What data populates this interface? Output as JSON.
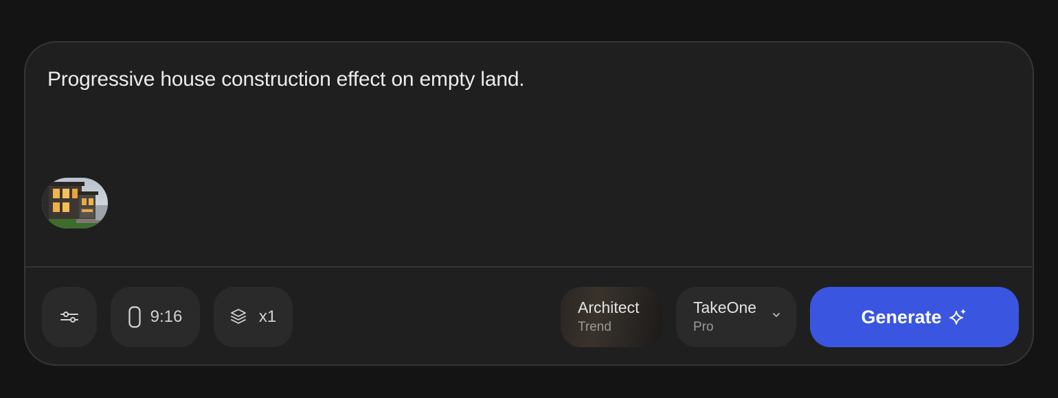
{
  "prompt": {
    "text": "Progressive house construction effect on empty land."
  },
  "attachment": {
    "icon": "house-photo-thumbnail"
  },
  "toolbar": {
    "settings_icon": "sliders-icon",
    "aspect_ratio": {
      "icon": "portrait-frame-icon",
      "label": "9:16"
    },
    "count": {
      "icon": "layers-icon",
      "label": "x1"
    },
    "style": {
      "title": "Architect",
      "subtitle": "Trend"
    },
    "model": {
      "title": "TakeOne",
      "subtitle": "Pro",
      "icon": "chevron-down-icon"
    },
    "generate": {
      "label": "Generate",
      "icon": "sparkle-icon"
    }
  },
  "colors": {
    "background": "#141414",
    "panel": "#1f1f1f",
    "button": "#2a2a2a",
    "accent": "#3a55e0"
  }
}
